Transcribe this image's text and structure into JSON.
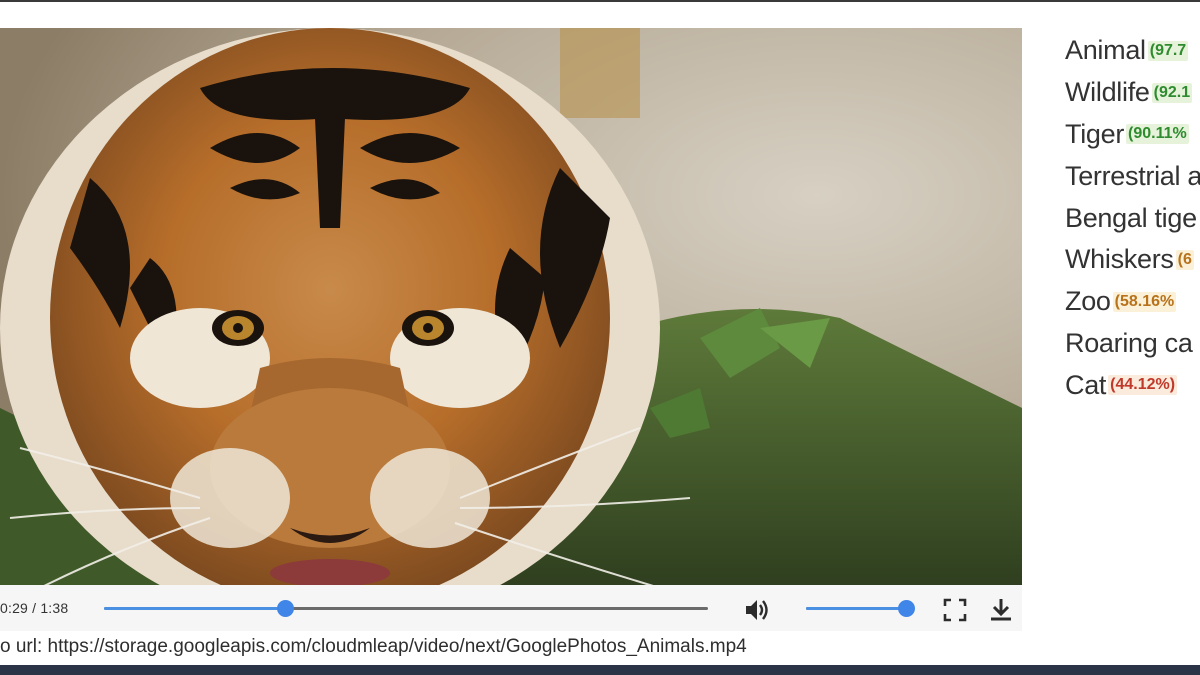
{
  "player": {
    "current_time": "0:29",
    "duration": "1:38",
    "time_display": "0:29 / 1:38",
    "progress_fraction": 0.3,
    "volume_fraction": 1.0
  },
  "source": {
    "url_line": "o url: https://storage.googleapis.com/cloudmleap/video/next/GooglePhotos_Animals.mp4"
  },
  "labels": [
    {
      "name": "Animal",
      "score": "(97.7",
      "level": "green"
    },
    {
      "name": "Wildlife",
      "score": "(92.1",
      "level": "green"
    },
    {
      "name": "Tiger",
      "score": "(90.11%",
      "level": "green"
    },
    {
      "name": "Terrestrial a",
      "score": "",
      "level": "green"
    },
    {
      "name": "Bengal tige",
      "score": "",
      "level": "green"
    },
    {
      "name": "Whiskers",
      "score": "(6",
      "level": "orange"
    },
    {
      "name": "Zoo",
      "score": "(58.16%",
      "level": "orange"
    },
    {
      "name": "Roaring ca",
      "score": "",
      "level": "orange"
    },
    {
      "name": "Cat",
      "score": "(44.12%)",
      "level": "red"
    }
  ],
  "icons": {
    "volume": "volume-icon",
    "fullscreen": "fullscreen-icon",
    "download": "download-icon"
  },
  "colors": {
    "accent": "#4a90e2",
    "score_green": "#2e8b2e",
    "score_orange": "#b8721b",
    "score_red": "#c0392b"
  }
}
